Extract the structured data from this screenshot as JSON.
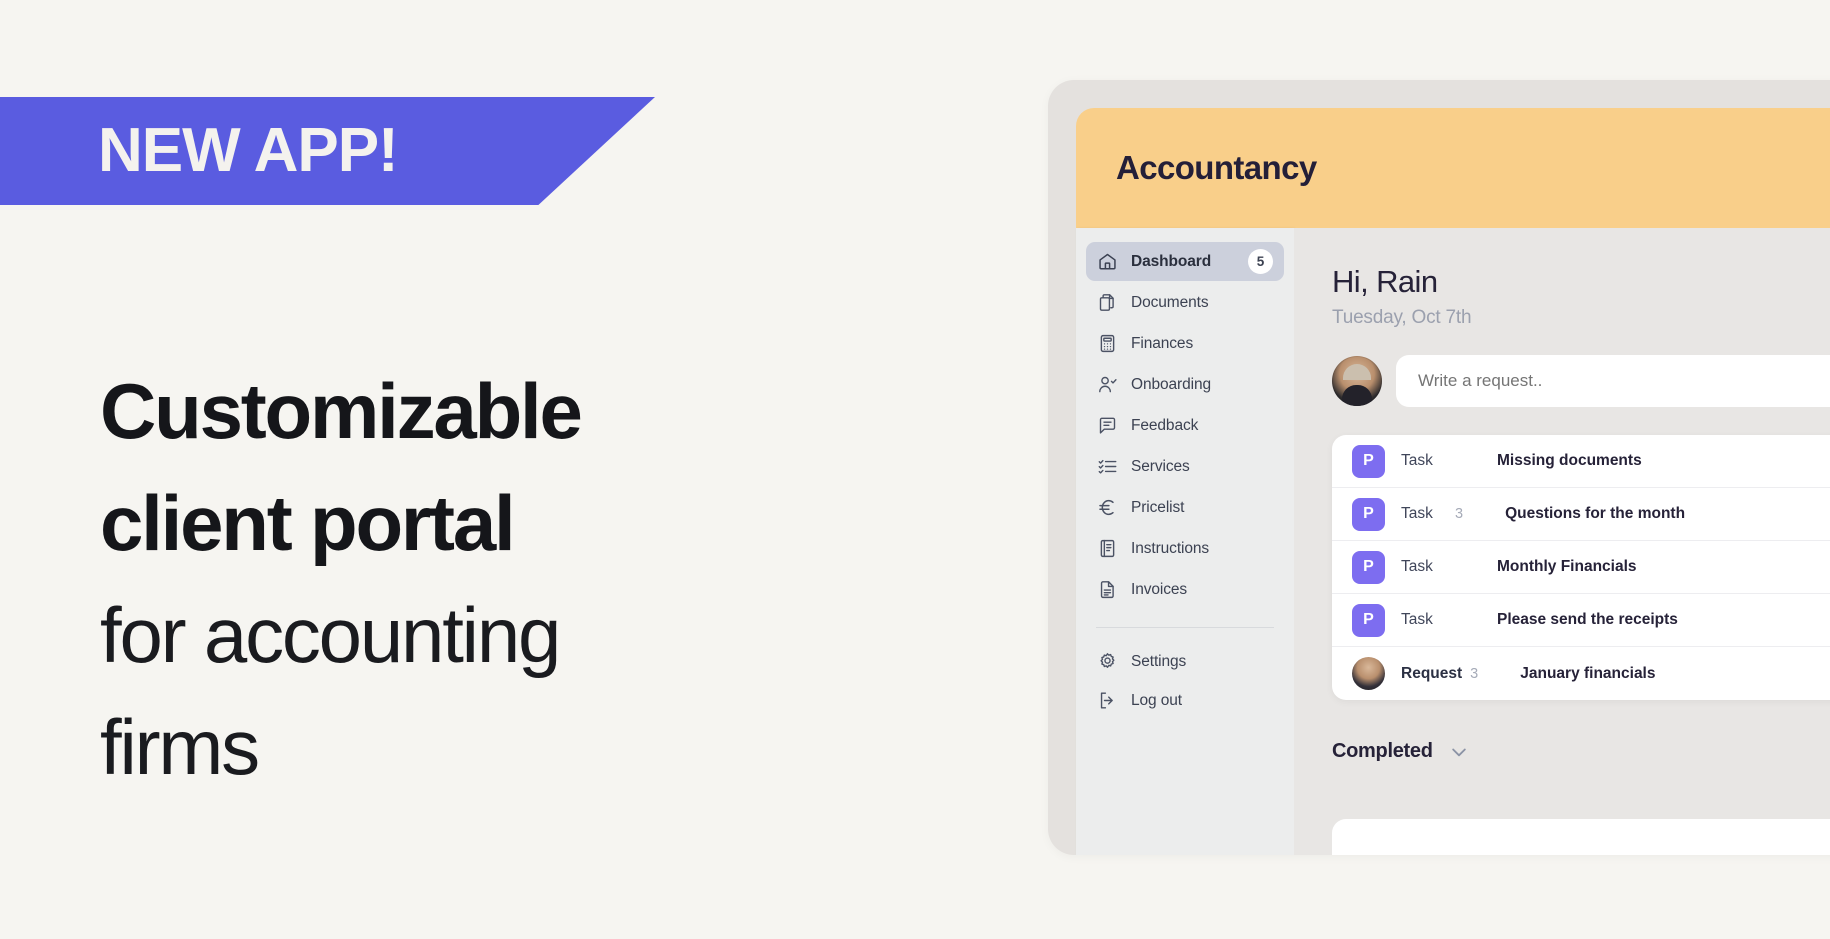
{
  "promo": {
    "banner_label": "NEW APP!",
    "headline_bold_1": "Customizable",
    "headline_bold_2": "client portal",
    "headline_light_1": "for accounting",
    "headline_light_2": "firms"
  },
  "colors": {
    "page_bg": "#f6f5f1",
    "banner_purple": "#5a5ce0",
    "header_amber": "#f9cf8a",
    "tag_purple": "#7d6df0",
    "sidebar_bg": "#eceded",
    "active_nav": "#ccd0dc"
  },
  "app": {
    "header": {
      "title": "Accountancy"
    },
    "sidebar": {
      "items": [
        {
          "label": "Dashboard",
          "icon": "home-icon",
          "badge": "5",
          "active": true
        },
        {
          "label": "Documents",
          "icon": "documents-icon",
          "badge": "",
          "active": false
        },
        {
          "label": "Finances",
          "icon": "calculator-icon",
          "badge": "",
          "active": false
        },
        {
          "label": "Onboarding",
          "icon": "user-check-icon",
          "badge": "",
          "active": false
        },
        {
          "label": "Feedback",
          "icon": "chat-icon",
          "badge": "",
          "active": false
        },
        {
          "label": "Services",
          "icon": "checklist-icon",
          "badge": "",
          "active": false
        },
        {
          "label": "Pricelist",
          "icon": "euro-icon",
          "badge": "",
          "active": false
        },
        {
          "label": "Instructions",
          "icon": "book-icon",
          "badge": "",
          "active": false
        },
        {
          "label": "Invoices",
          "icon": "invoice-icon",
          "badge": "",
          "active": false
        }
      ],
      "bottom_items": [
        {
          "label": "Settings",
          "icon": "gear-icon"
        },
        {
          "label": "Log out",
          "icon": "logout-icon"
        }
      ]
    },
    "main": {
      "greeting": "Hi, Rain",
      "date": "Tuesday, Oct 7th",
      "request_placeholder": "Write a request..",
      "tasks": [
        {
          "badge": "P",
          "badge_type": "tag",
          "kind": "Task",
          "count": "",
          "title": "Missing documents"
        },
        {
          "badge": "P",
          "badge_type": "tag",
          "kind": "Task",
          "count": "3",
          "title": "Questions for the month"
        },
        {
          "badge": "P",
          "badge_type": "tag",
          "kind": "Task",
          "count": "",
          "title": "Monthly Financials"
        },
        {
          "badge": "P",
          "badge_type": "tag",
          "kind": "Task",
          "count": "",
          "title": "Please send the receipts"
        },
        {
          "badge": "",
          "badge_type": "avatar",
          "kind": "Request",
          "count": "3",
          "title": "January financials"
        }
      ],
      "completed_label": "Completed"
    }
  }
}
